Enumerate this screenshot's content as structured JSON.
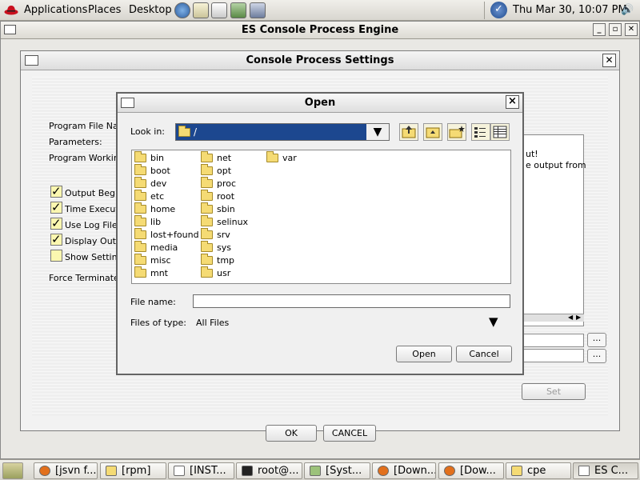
{
  "top_panel": {
    "menus": [
      "Applications",
      "Places",
      "Desktop"
    ],
    "clock": "Thu Mar 30, 10:07 PM",
    "launcher_icons": [
      "web-browser-icon",
      "email-icon",
      "notes-icon",
      "presentation-icon",
      "network-icon"
    ]
  },
  "main_window": {
    "title": "ES Console Process Engine"
  },
  "settings_dialog": {
    "title": "Console Process Settings",
    "labels": {
      "program_file": "Program File Na",
      "parameters": "Parameters:",
      "working_dir": "Program Workin",
      "force_terminate": "Force Terminate"
    },
    "checkboxes": [
      {
        "label": "Output Begin",
        "checked": true
      },
      {
        "label": "Time Execut",
        "checked": true
      },
      {
        "label": "Use Log File",
        "checked": true
      },
      {
        "label": "Display Outp",
        "checked": true
      },
      {
        "label": "Show Setting",
        "checked": false
      }
    ],
    "text_area_lines": [
      "ut!",
      "e output from"
    ],
    "browse_label": "...",
    "set_label": "Set",
    "ok_label": "OK",
    "cancel_label": "CANCEL"
  },
  "open_dialog": {
    "title": "Open",
    "close_label": "×",
    "look_in_label": "Look in:",
    "look_in_value": "/",
    "files": [
      "bin",
      "boot",
      "dev",
      "etc",
      "home",
      "lib",
      "lost+found",
      "media",
      "misc",
      "mnt",
      "net",
      "opt",
      "proc",
      "root",
      "sbin",
      "selinux",
      "srv",
      "sys",
      "tmp",
      "usr",
      "var"
    ],
    "file_name_label": "File name:",
    "file_name_value": "",
    "files_of_type_label": "Files of type:",
    "files_of_type_value": "All Files",
    "open_button": "Open",
    "cancel_button": "Cancel"
  },
  "taskbar": {
    "tasks": [
      {
        "label": "[jsvn f...",
        "icon": "firefox-icon"
      },
      {
        "label": "[rpm]",
        "icon": "folder-icon"
      },
      {
        "label": "[INST...",
        "icon": "editor-icon"
      },
      {
        "label": "root@...",
        "icon": "terminal-icon"
      },
      {
        "label": "[Syst...",
        "icon": "system-icon"
      },
      {
        "label": "[Down...",
        "icon": "firefox-icon"
      },
      {
        "label": "[Dow...",
        "icon": "firefox-icon"
      },
      {
        "label": "cpe",
        "icon": "folder-icon"
      },
      {
        "label": "ES C...",
        "icon": "window-icon"
      }
    ]
  },
  "colors": {
    "selection": "#1c478f",
    "checkbox_fill": "#fbf7b0",
    "folder": "#f5db74"
  }
}
